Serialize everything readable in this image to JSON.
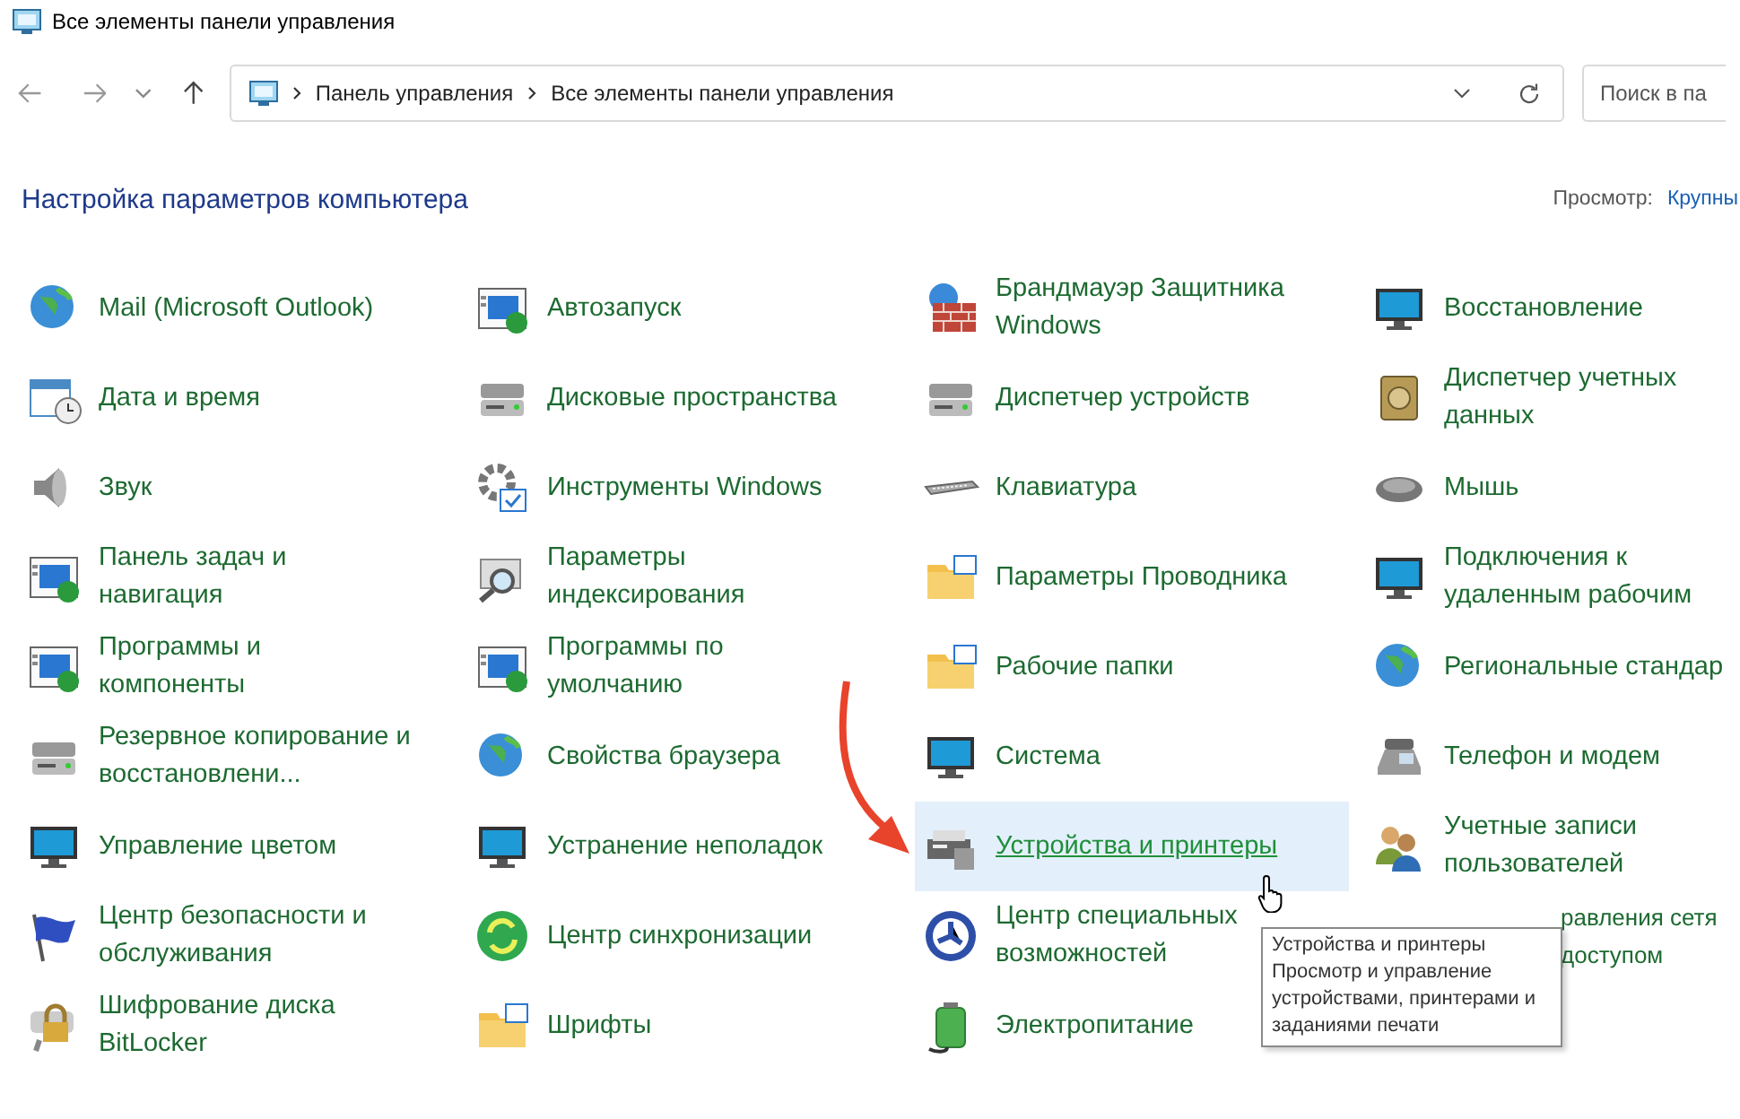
{
  "window": {
    "title": "Все элементы панели управления"
  },
  "address_bar": {
    "crumbs": [
      "Панель управления",
      "Все элементы панели управления"
    ]
  },
  "search": {
    "placeholder": "Поиск в па"
  },
  "header": {
    "title": "Настройка параметров компьютера",
    "view_label": "Просмотр:",
    "view_value": "Крупны"
  },
  "items": [
    {
      "label": "Mail (Microsoft Outlook)",
      "hovered": false,
      "covered": false
    },
    {
      "label": "Автозапуск",
      "hovered": false,
      "covered": false
    },
    {
      "label": "Брандмауэр Защитника\nWindows",
      "hovered": false,
      "covered": false
    },
    {
      "label": "Восстановление",
      "hovered": false,
      "covered": false
    },
    {
      "label": "Дата и время",
      "hovered": false,
      "covered": false
    },
    {
      "label": "Дисковые пространства",
      "hovered": false,
      "covered": false
    },
    {
      "label": "Диспетчер устройств",
      "hovered": false,
      "covered": false
    },
    {
      "label": "Диспетчер учетных\nданных",
      "hovered": false,
      "covered": false
    },
    {
      "label": "Звук",
      "hovered": false,
      "covered": false
    },
    {
      "label": "Инструменты Windows",
      "hovered": false,
      "covered": false
    },
    {
      "label": "Клавиатура",
      "hovered": false,
      "covered": false
    },
    {
      "label": "Мышь",
      "hovered": false,
      "covered": false
    },
    {
      "label": "Панель задач и\nнавигация",
      "hovered": false,
      "covered": false
    },
    {
      "label": "Параметры\nиндексирования",
      "hovered": false,
      "covered": false
    },
    {
      "label": "Параметры Проводника",
      "hovered": false,
      "covered": false
    },
    {
      "label": "Подключения к\nудаленным рабочим",
      "hovered": false,
      "covered": false
    },
    {
      "label": "Программы и\nкомпоненты",
      "hovered": false,
      "covered": false
    },
    {
      "label": "Программы по\nумолчанию",
      "hovered": false,
      "covered": false
    },
    {
      "label": "Рабочие папки",
      "hovered": false,
      "covered": false
    },
    {
      "label": "Региональные стандар",
      "hovered": false,
      "covered": false
    },
    {
      "label": "Резервное копирование и\nвосстановлени...",
      "hovered": false,
      "covered": false
    },
    {
      "label": "Свойства браузера",
      "hovered": false,
      "covered": false
    },
    {
      "label": "Система",
      "hovered": false,
      "covered": false
    },
    {
      "label": "Телефон и модем",
      "hovered": false,
      "covered": false
    },
    {
      "label": "Управление цветом",
      "hovered": false,
      "covered": false
    },
    {
      "label": "Устранение неполадок",
      "hovered": false,
      "covered": false
    },
    {
      "label": "Устройства и принтеры",
      "hovered": true,
      "covered": false
    },
    {
      "label": "Учетные записи\nпользователей",
      "hovered": false,
      "covered": false
    },
    {
      "label": "Центр безопасности и\nобслуживания",
      "hovered": false,
      "covered": false
    },
    {
      "label": "Центр синхронизации",
      "hovered": false,
      "covered": false
    },
    {
      "label": "Центр специальных\nвозможностей",
      "hovered": false,
      "covered": false
    },
    {
      "label": "равления сетя\nдоступом",
      "hovered": false,
      "covered": true
    },
    {
      "label": "Шифрование диска\nBitLocker",
      "hovered": false,
      "covered": false
    },
    {
      "label": "Шрифты",
      "hovered": false,
      "covered": false
    },
    {
      "label": "Электропитание",
      "hovered": false,
      "covered": false
    }
  ],
  "tooltip": {
    "title": "Устройства и принтеры",
    "text": "Просмотр и управление устройствами, принтерами и заданиями печати"
  }
}
